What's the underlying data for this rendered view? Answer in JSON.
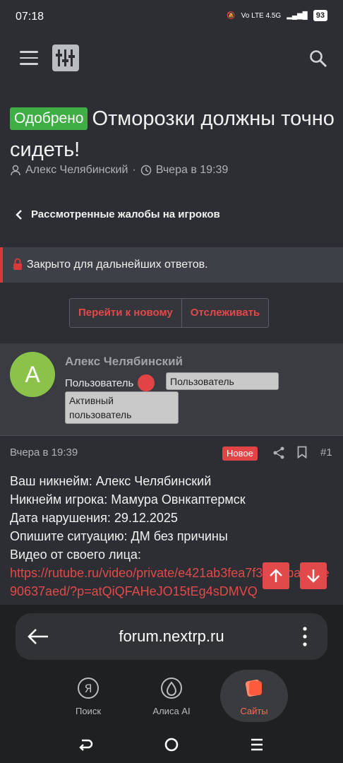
{
  "status": {
    "time": "07:18",
    "net": "Vo LTE 4.5G",
    "battery": "93"
  },
  "thread": {
    "badge": "Одобрено",
    "title": "Отморозки должны точно сидеть!",
    "author": "Алекс Челябинский",
    "when": "Вчера в 19:39",
    "breadcrumb": "Рассмотренные жалобы на игроков",
    "closed_text": "Закрыто для дальнейших ответов."
  },
  "actions": {
    "goto_new": "Перейти к новому",
    "watch": "Отслеживать"
  },
  "user": {
    "initial": "A",
    "name": "Алекс Челябинский",
    "role": "Пользователь",
    "tag1": "Пользователь",
    "tag2": "Активный пользователь"
  },
  "post": {
    "date": "Вчера в 19:39",
    "new_badge": "Новое",
    "number": "#1",
    "lines": [
      "Ваш никнейм: Алекс Челябинский",
      "Никнейм игрока: Мамура Овнкаптермск",
      "Дата нарушения: 29.12.2025",
      "Опишите ситуацию: ДМ без причины",
      "Видео от своего лица:"
    ],
    "link": "https://rutube.ru/video/private/e421ab3fea7f30fc0ba387e90637aed/?p=atQiQFAHeJO15tEg4sDMVQ"
  },
  "browser": {
    "url": "forum.nextrp.ru",
    "tabs": [
      "Поиск",
      "Алиса AI",
      "Сайты"
    ]
  },
  "colors": {
    "accent": "#e2494a",
    "approved": "#3fae44",
    "bg": "#2c2e33"
  }
}
